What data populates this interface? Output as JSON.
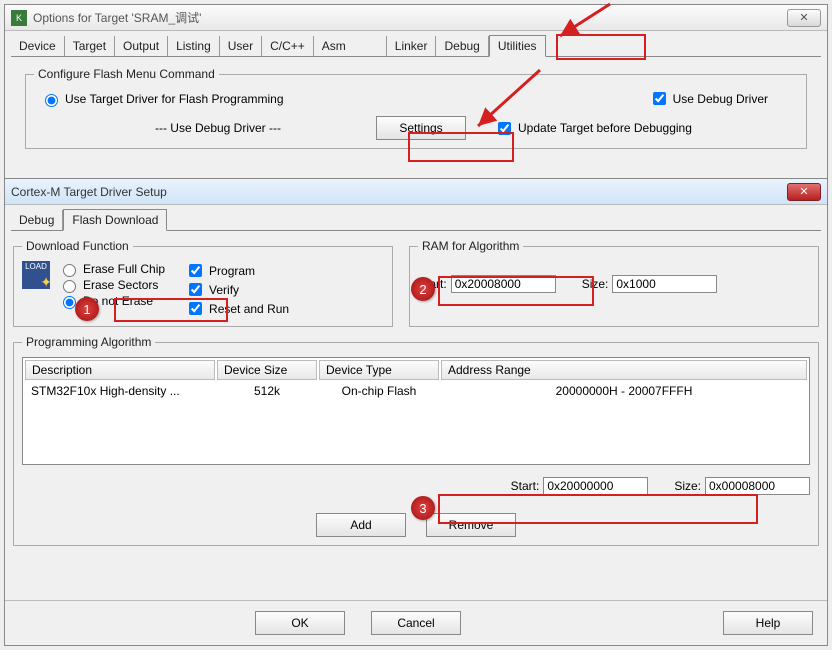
{
  "win1": {
    "title": "Options for Target 'SRAM_调试'",
    "tabs": [
      "Device",
      "Target",
      "Output",
      "Listing",
      "User",
      "C/C++",
      "Asm",
      "Linker",
      "Debug",
      "Utilities"
    ],
    "active_tab": 9,
    "group1_title": "Configure Flash Menu Command",
    "radio1": "Use Target Driver for Flash Programming",
    "driver_text": "--- Use Debug Driver ---",
    "settings_btn": "Settings",
    "chk_use_debug": "Use Debug Driver",
    "chk_update": "Update Target before Debugging"
  },
  "win2": {
    "title": "Cortex-M Target Driver Setup",
    "tabs": [
      "Debug",
      "Flash Download"
    ],
    "active_tab": 1,
    "dlgroup": "Download Function",
    "erase_full": "Erase Full Chip",
    "erase_sectors": "Erase Sectors",
    "do_not_erase": "Do not Erase",
    "chk_program": "Program",
    "chk_verify": "Verify",
    "chk_reset": "Reset and Run",
    "ramgroup": "RAM for Algorithm",
    "start_label": "Start:",
    "size_label": "Size:",
    "ram_start": "0x20008000",
    "ram_size": "0x1000",
    "pagroup": "Programming Algorithm",
    "th_desc": "Description",
    "th_size": "Device Size",
    "th_type": "Device Type",
    "th_range": "Address Range",
    "row": {
      "desc": "STM32F10x High-density ...",
      "size": "512k",
      "type": "On-chip Flash",
      "range": "20000000H - 20007FFFH"
    },
    "pa_start": "0x20000000",
    "pa_size": "0x00008000",
    "add_btn": "Add",
    "remove_btn": "Remove",
    "ok": "OK",
    "cancel": "Cancel",
    "help": "Help",
    "load_label": "LOAD"
  },
  "callouts": {
    "c1": "1",
    "c2": "2",
    "c3": "3"
  }
}
